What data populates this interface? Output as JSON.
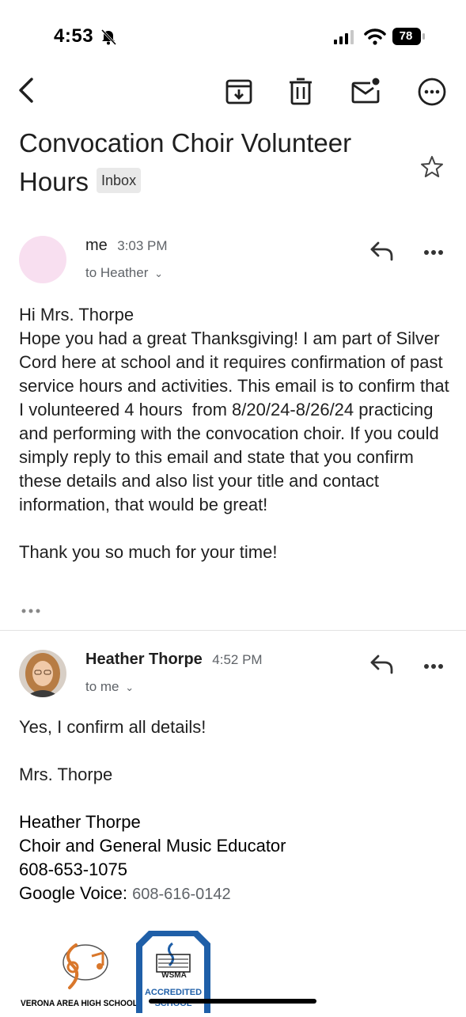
{
  "status_bar": {
    "time": "4:53",
    "battery": "78"
  },
  "toolbar": {
    "back": "back-arrow-icon",
    "archive": "archive-icon",
    "delete": "trash-icon",
    "mark_unread": "mail-unread-icon",
    "more": "more-options-icon"
  },
  "subject": {
    "line1": "Convocation Choir Volunteer",
    "line2": "Hours",
    "label": "Inbox"
  },
  "messages": [
    {
      "sender": "me",
      "time": "3:03 PM",
      "recipient": "to Heather",
      "body": "Hi Mrs. Thorpe\nHope you had a great Thanksgiving! I am part of Silver Cord here at school and it requires confirmation of past service hours and activities. This email is to confirm that I volunteered 4 hours  from 8/20/24-8/26/24 practicing and performing with the convocation choir. If you could simply reply to this email and state that you confirm these details and also list your title and contact information, that would be great!\n\nThank you so much for your time!"
    },
    {
      "sender": "Heather Thorpe",
      "time": "4:52 PM",
      "recipient": "to me",
      "body_line1": "Yes, I confirm all details!",
      "body_line2": "Mrs. Thorpe",
      "signature": {
        "name": "Heather Thorpe",
        "title": "Choir and General Music Educator",
        "phone": "608-653-1075",
        "gv_label": "Google Voice:",
        "gv_number": "608-616-0142"
      },
      "logos": {
        "school": "VERONA AREA HIGH SCHOOL",
        "wsma": "WSMA",
        "accredited": "ACCREDITED",
        "school_word": "SCHOOL"
      }
    }
  ],
  "colors": {
    "avatar_me": "#f8dff0",
    "accent_blue": "#1f5fa8",
    "logo_orange": "#d9772b"
  }
}
